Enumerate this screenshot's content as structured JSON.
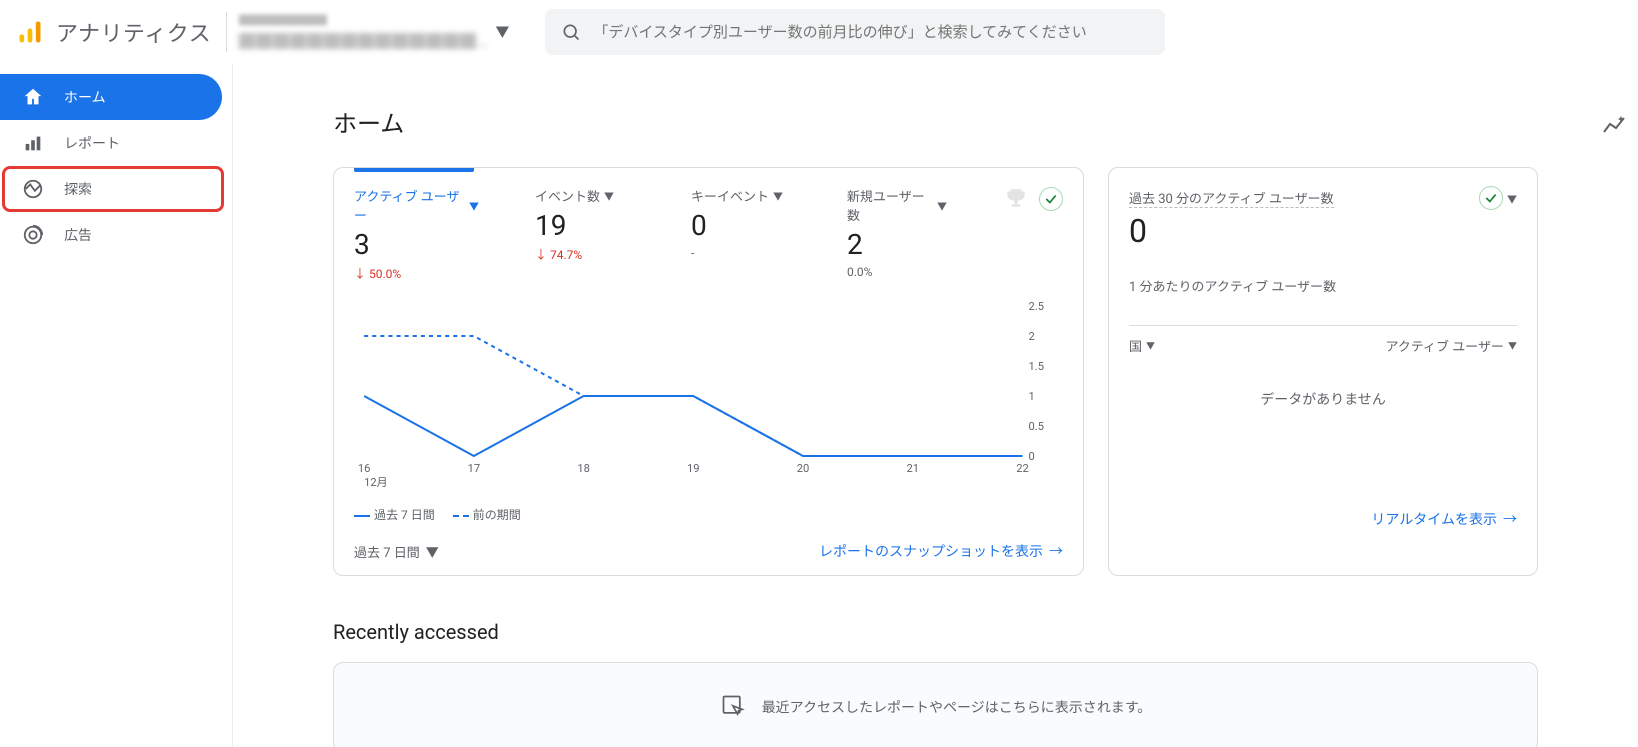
{
  "header": {
    "product_name": "アナリティクス",
    "search_placeholder": "「デバイスタイプ別ユーザー数の前月比の伸び」と検索してみてください"
  },
  "sidebar": {
    "items": [
      {
        "label": "ホーム",
        "icon": "home-icon"
      },
      {
        "label": "レポート",
        "icon": "reports-icon"
      },
      {
        "label": "探索",
        "icon": "explore-icon"
      },
      {
        "label": "広告",
        "icon": "ads-icon"
      }
    ]
  },
  "main": {
    "title": "ホーム",
    "metrics": [
      {
        "label": "アクティブ ユーザー",
        "value": "3",
        "delta": "↓ 50.0%",
        "delta_class": "down"
      },
      {
        "label": "イベント数",
        "value": "19",
        "delta": "↓ 74.7%",
        "delta_class": "down"
      },
      {
        "label": "キーイベント",
        "value": "0",
        "delta": "-",
        "delta_class": "flat"
      },
      {
        "label": "新規ユーザー数",
        "value": "2",
        "delta": "0.0%",
        "delta_class": "flat"
      }
    ],
    "legend": {
      "current": "過去 7 日間",
      "previous": "前の期間"
    },
    "date_range": "過去 7 日間",
    "snapshot_link": "レポートのスナップショットを表示",
    "realtime": {
      "title": "過去 30 分のアクティブ ユーザー数",
      "value": "0",
      "subtitle": "1 分あたりのアクティブ ユーザー数",
      "col1": "国",
      "col2": "アクティブ ユーザー",
      "empty": "データがありません",
      "link": "リアルタイムを表示"
    },
    "recently": {
      "title": "Recently accessed",
      "empty": "最近アクセスしたレポートやページはこちらに表示されます。"
    }
  },
  "chart_data": {
    "type": "line",
    "x": [
      "16",
      "17",
      "18",
      "19",
      "20",
      "21",
      "22"
    ],
    "x_sublabel": "12月",
    "ylim": [
      0,
      2.5
    ],
    "y_ticks": [
      0,
      0.5,
      1,
      1.5,
      2,
      2.5
    ],
    "series": [
      {
        "name": "過去 7 日間",
        "style": "solid",
        "values": [
          1,
          0,
          1,
          1,
          0,
          0,
          0
        ]
      },
      {
        "name": "前の期間",
        "style": "dashed",
        "values": [
          2,
          2,
          1,
          1,
          0,
          0,
          0
        ]
      }
    ]
  }
}
